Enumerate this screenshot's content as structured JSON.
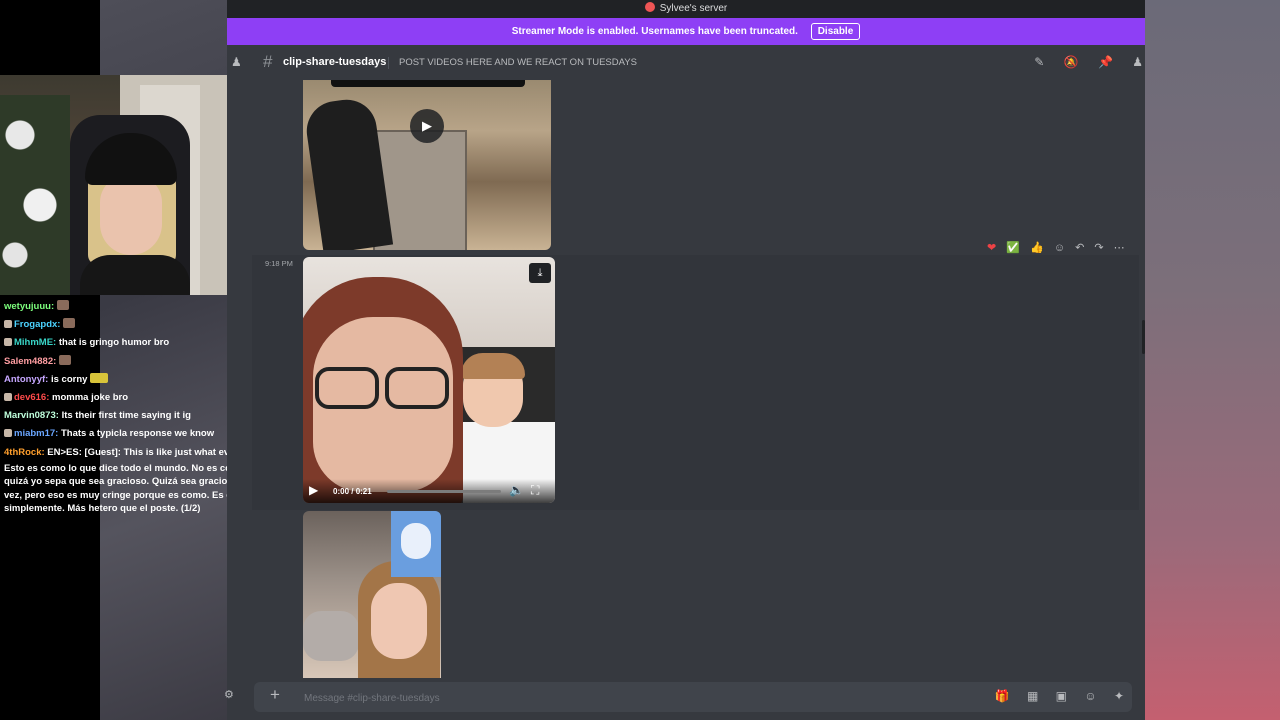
{
  "window": {
    "server_name": "Sylvee's server"
  },
  "banner": {
    "text": "Streamer Mode is enabled. Usernames have been truncated.",
    "disable_label": "Disable"
  },
  "channel": {
    "name": "clip-share-tuesdays",
    "topic": "POST VIDEOS HERE AND WE REACT ON TUESDAYS"
  },
  "message": {
    "timestamp": "9:18 PM",
    "video": {
      "current_time": "0:00",
      "duration": "0:21",
      "progress": 0
    }
  },
  "composer": {
    "placeholder": "Message #clip-share-tuesdays"
  },
  "twitch_chat": [
    {
      "user": "wetyujuuu:",
      "text": "",
      "color": "#7dff7d"
    },
    {
      "user": "Frogapdx:",
      "text": "",
      "color": "#4cd3ff"
    },
    {
      "user": "MihmME:",
      "text": "that is gringo humor bro",
      "color": "#39d6c8"
    },
    {
      "user": "Salem4882:",
      "text": "",
      "color": "#ff9ea2"
    },
    {
      "user": "Antonyyf:",
      "text": "is corny",
      "color": "#c6a7ff"
    },
    {
      "user": "dev616:",
      "text": "momma joke bro",
      "color": "#ff4b4b"
    },
    {
      "user": "Marvin0873:",
      "text": "Its their first time saying it ig",
      "color": "#bfffdc"
    },
    {
      "user": "miabm17:",
      "text": "Thats a typicla response we know",
      "color": "#6aa6ff"
    },
    {
      "user": "4thRock:",
      "text": "EN>ES: [Guest]: This is like just what ev",
      "color": "#ff9f2d"
    }
  ],
  "twitch_chat_continuation": "Esto es como lo que dice todo el mundo. No es cc quizá yo sepa que sea gracioso. Quizá sea gracios vez, pero eso es muy cringe porque es como. Es c simplemente. Más hetero que el poste. (1/2)"
}
